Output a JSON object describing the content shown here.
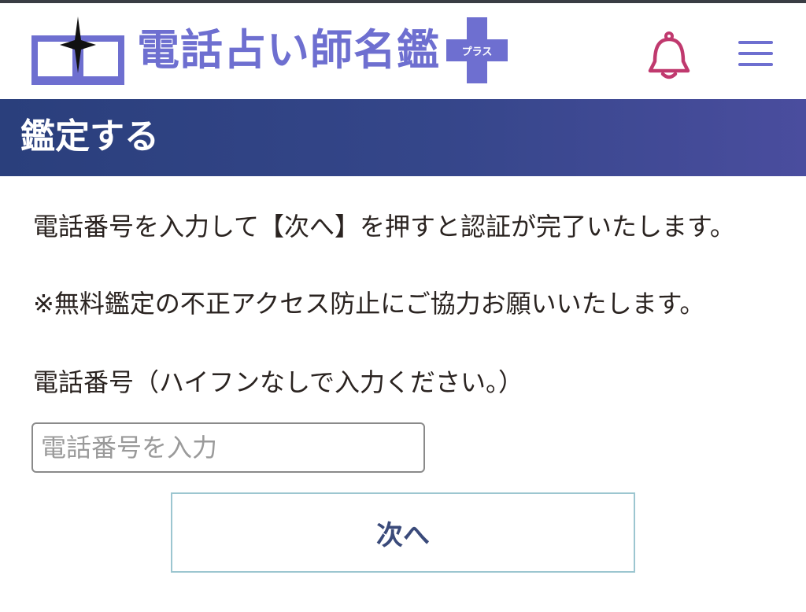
{
  "header": {
    "logo_text": "電話占い師名鑑",
    "logo_badge": "プラス",
    "icons": [
      "book-icon",
      "bell-icon",
      "hamburger-menu-icon"
    ],
    "colors": {
      "logo": "#6e6fd0",
      "bell": "#c0396e",
      "menu": "#6e6fd0"
    }
  },
  "section": {
    "title": "鑑定する",
    "gradient": [
      "#2a3f7c",
      "#4a4d9e"
    ]
  },
  "main": {
    "intro": "電話番号を入力して【次へ】を押すと認証が完了いたします。",
    "note": "※無料鑑定の不正アクセス防止にご協力お願いいたします。",
    "field_label": "電話番号（ハイフンなしで入力ください。）",
    "phone_placeholder": "電話番号を入力",
    "phone_value": "",
    "next_button": "次へ"
  }
}
